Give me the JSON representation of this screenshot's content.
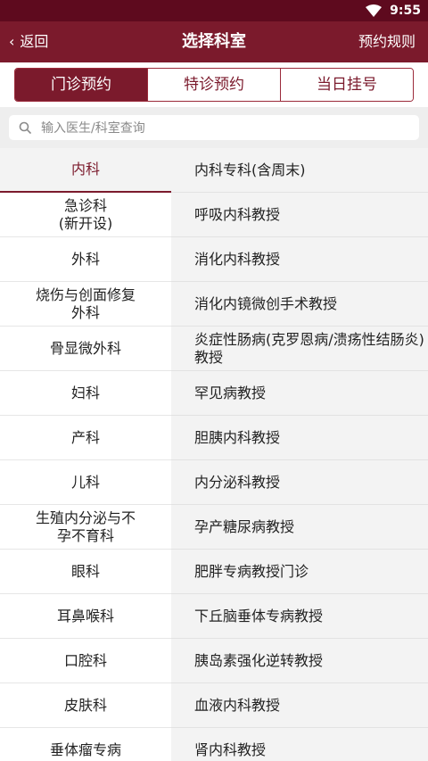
{
  "status": {
    "time": "9:55"
  },
  "header": {
    "back_label": "返回",
    "title": "选择科室",
    "rules_label": "预约规则"
  },
  "tabs": [
    {
      "label": "门诊预约",
      "active": true
    },
    {
      "label": "特诊预约",
      "active": false
    },
    {
      "label": "当日挂号",
      "active": false
    }
  ],
  "search": {
    "placeholder": "输入医生/科室查询",
    "value": ""
  },
  "departments": [
    {
      "label": "内科",
      "active": true
    },
    {
      "label": "急诊科\n(新开设)"
    },
    {
      "label": "外科"
    },
    {
      "label": "烧伤与创面修复\n外科"
    },
    {
      "label": "骨显微外科"
    },
    {
      "label": "妇科"
    },
    {
      "label": "产科"
    },
    {
      "label": "儿科"
    },
    {
      "label": "生殖内分泌与不\n孕不育科"
    },
    {
      "label": "眼科"
    },
    {
      "label": "耳鼻喉科"
    },
    {
      "label": "口腔科"
    },
    {
      "label": "皮肤科"
    },
    {
      "label": "垂体瘤专病"
    }
  ],
  "subdepartments": [
    "内科专科(含周末)",
    "呼吸内科教授",
    "消化内科教授",
    "消化内镜微创手术教授",
    "炎症性肠病(克罗恩病/溃疡性结肠炎)教授",
    "罕见病教授",
    "胆胰内科教授",
    "内分泌科教授",
    "孕产糖尿病教授",
    "肥胖专病教授门诊",
    "下丘脑垂体专病教授",
    "胰岛素强化逆转教授",
    "血液内科教授",
    "肾内科教授"
  ],
  "colors": {
    "primary": "#7b1a2c",
    "statusbar": "#5e0a1e"
  }
}
